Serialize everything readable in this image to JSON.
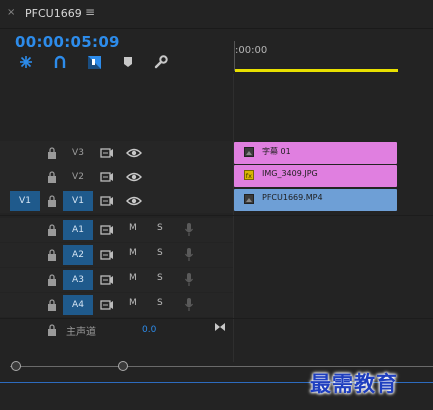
{
  "panel": {
    "close_glyph": "×",
    "title": "PFCU1669",
    "menu_glyph": "≡"
  },
  "timecode": "00:00:05:09",
  "toolbar": {
    "icons": [
      "snap-icon",
      "linked-selection-icon",
      "add-marker-icon",
      "marker-icon",
      "wrench-icon"
    ]
  },
  "ruler": {
    "start_label": ":00:00"
  },
  "tracks": {
    "v3": {
      "name": "V3"
    },
    "v2": {
      "name": "V2"
    },
    "v1": {
      "name": "V1",
      "source": "V1"
    },
    "a1": {
      "name": "A1",
      "mute": "M",
      "solo": "S"
    },
    "a2": {
      "name": "A2",
      "mute": "M",
      "solo": "S"
    },
    "a3": {
      "name": "A3",
      "mute": "M",
      "solo": "S"
    },
    "a4": {
      "name": "A4",
      "mute": "M",
      "solo": "S"
    }
  },
  "master": {
    "label": "主声道",
    "value": "0.0"
  },
  "clips": {
    "v3": {
      "name": "字幕 01",
      "color": "#e07fe0"
    },
    "v2": {
      "name": "IMG_3409.JPG",
      "color": "#e07fe0"
    },
    "v1": {
      "name": "PFCU1669.MP4",
      "color": "#6e9fd6"
    }
  },
  "colors": {
    "accent": "#2d8ceb",
    "workbar": "#e8e000"
  },
  "watermark": "最需教育"
}
